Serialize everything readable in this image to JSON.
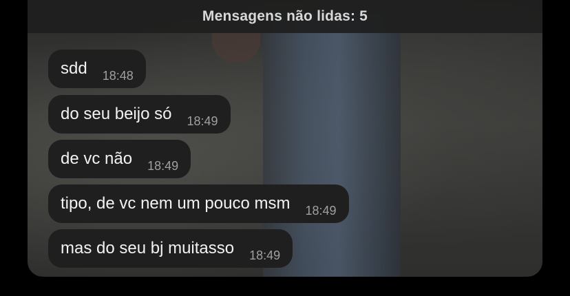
{
  "banner": {
    "text": "Mensagens não lidas: 5"
  },
  "messages": [
    {
      "text": "sdd",
      "time": "18:48"
    },
    {
      "text": "do seu beijo só",
      "time": "18:49"
    },
    {
      "text": "de vc não",
      "time": "18:49"
    },
    {
      "text": "tipo, de vc nem um pouco msm",
      "time": "18:49"
    },
    {
      "text": "mas do seu bj muitasso",
      "time": "18:49"
    }
  ]
}
